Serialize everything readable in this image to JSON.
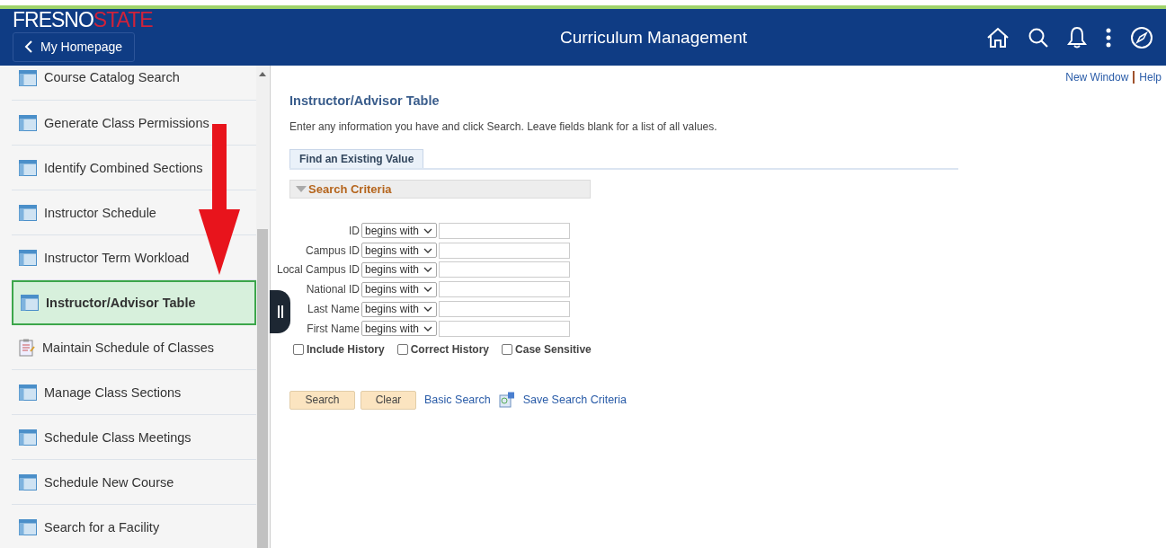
{
  "header": {
    "logo_left": "FRESNO",
    "logo_right": "STATE",
    "back_button": "My Homepage",
    "title": "Curriculum Management"
  },
  "sidebar": {
    "items": [
      {
        "label": "Course Catalog Search",
        "kind": "table",
        "selected": false
      },
      {
        "label": "Generate Class Permissions",
        "kind": "table",
        "selected": false
      },
      {
        "label": "Identify Combined Sections",
        "kind": "table",
        "selected": false
      },
      {
        "label": "Instructor Schedule",
        "kind": "table",
        "selected": false
      },
      {
        "label": "Instructor Term Workload",
        "kind": "table",
        "selected": false
      },
      {
        "label": "Instructor/Advisor Table",
        "kind": "table",
        "selected": true
      },
      {
        "label": "Maintain Schedule of Classes",
        "kind": "clipboard",
        "selected": false
      },
      {
        "label": "Manage Class Sections",
        "kind": "table",
        "selected": false
      },
      {
        "label": "Schedule Class Meetings",
        "kind": "table",
        "selected": false
      },
      {
        "label": "Schedule New Course",
        "kind": "table",
        "selected": false
      },
      {
        "label": "Search for a Facility",
        "kind": "table",
        "selected": false
      }
    ]
  },
  "top_links": [
    "New Window",
    "Help"
  ],
  "page": {
    "title": "Instructor/Advisor Table",
    "instructions": "Enter any information you have and click Search. Leave fields blank for a list of all values.",
    "tabs": [
      {
        "label": "Find an Existing Value",
        "selected": true
      }
    ],
    "section": {
      "label": "Search Criteria",
      "expanded": true
    },
    "fields": [
      {
        "label": "ID",
        "operator": "begins with"
      },
      {
        "label": "Campus ID",
        "operator": "begins with"
      },
      {
        "label": "Local Campus ID",
        "operator": "begins with"
      },
      {
        "label": "National ID",
        "operator": "begins with"
      },
      {
        "label": "Last Name",
        "operator": "begins with"
      },
      {
        "label": "First Name",
        "operator": "begins with"
      }
    ],
    "options": [
      {
        "label": "Include History",
        "checked": false
      },
      {
        "label": "Correct History",
        "checked": false
      },
      {
        "label": "Case Sensitive",
        "checked": false
      }
    ],
    "buttons": [
      "Search",
      "Clear"
    ],
    "links": [
      "Basic Search",
      "Save Search Criteria"
    ]
  }
}
